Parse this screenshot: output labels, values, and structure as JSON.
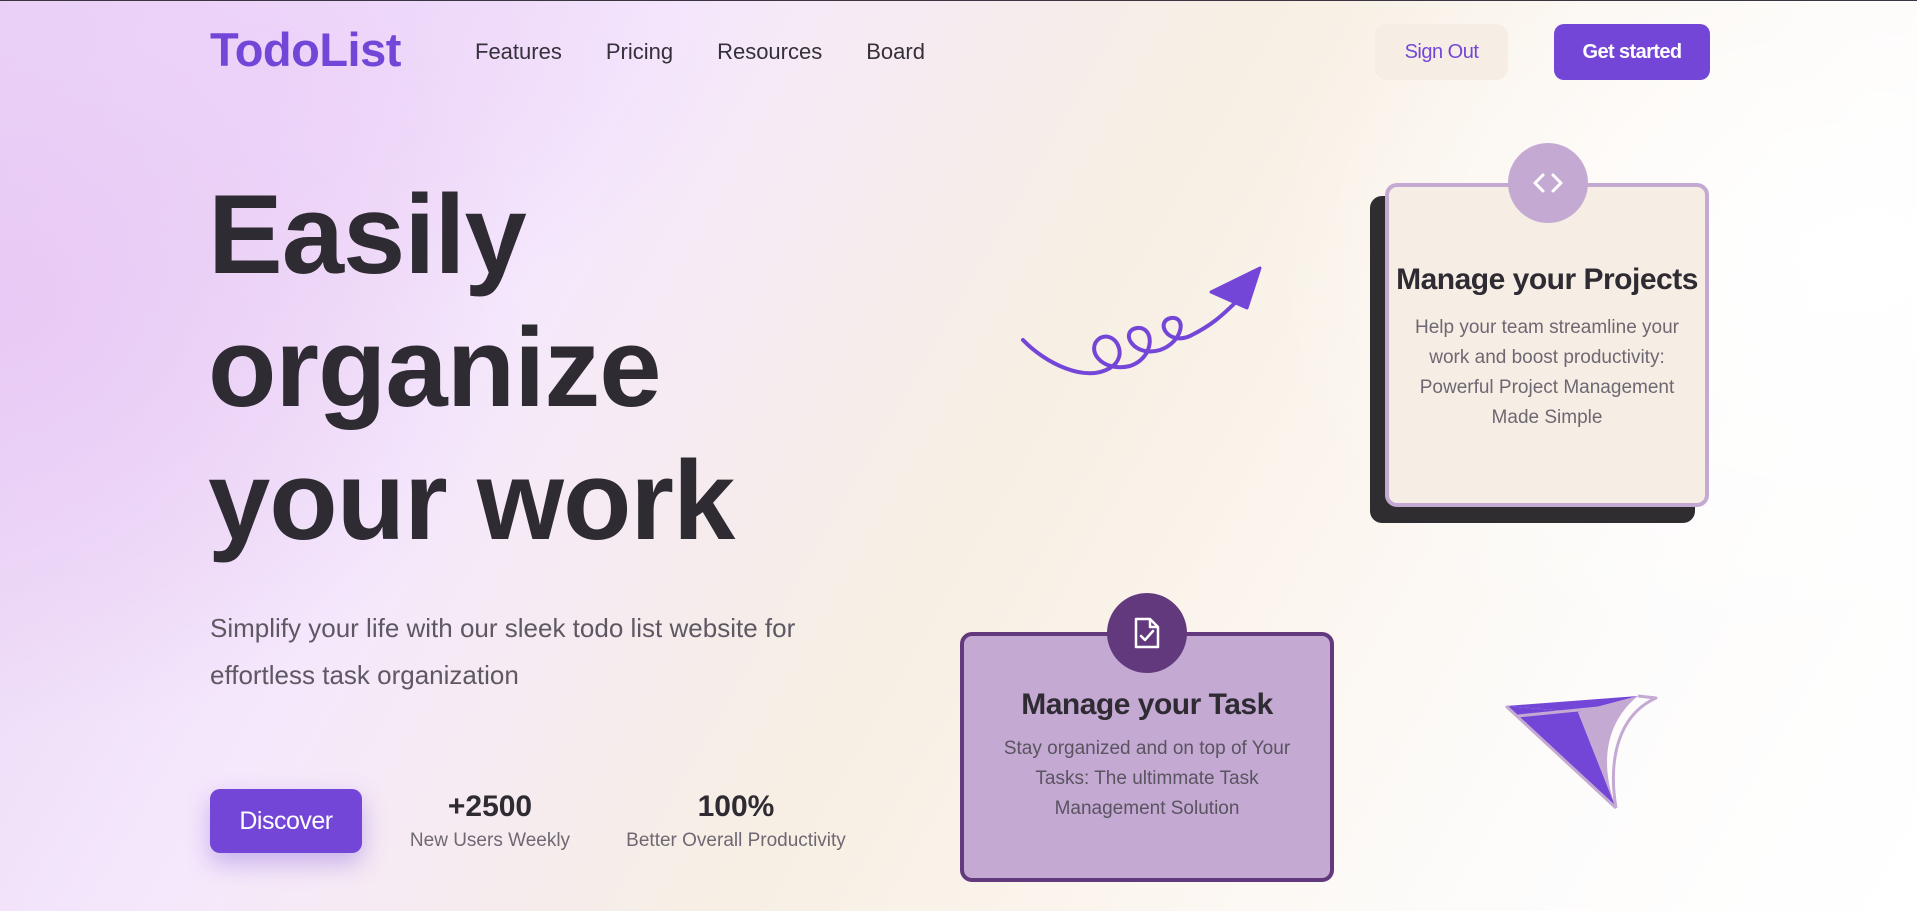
{
  "nav": {
    "logo": "TodoList",
    "links": [
      "Features",
      "Pricing",
      "Resources",
      "Board"
    ],
    "sign_out": "Sign Out",
    "get_started": "Get started"
  },
  "hero": {
    "title_lines": [
      "Easily",
      "organize",
      "your work"
    ],
    "subtitle": "Simplify your life with our sleek todo list website for effortless task organization",
    "discover": "Discover"
  },
  "stats": [
    {
      "value": "+2500",
      "label": "New Users Weekly"
    },
    {
      "value": "100%",
      "label": "Better Overall Productivity"
    }
  ],
  "cards": {
    "projects": {
      "icon": "code-icon",
      "title": "Manage your Projects",
      "desc": "Help your team streamline your work and boost productivity: Powerful Project Management Made Simple"
    },
    "task": {
      "icon": "file-check-icon",
      "title": "Manage your Task",
      "desc": "Stay organized and on top of Your Tasks: The ultimmate Task Management Solution"
    }
  },
  "colors": {
    "accent": "#7446d8",
    "lavender": "#c4a9d3",
    "deep_purple": "#63397e",
    "cream": "#f6ede4",
    "dark": "#2f2b33"
  }
}
